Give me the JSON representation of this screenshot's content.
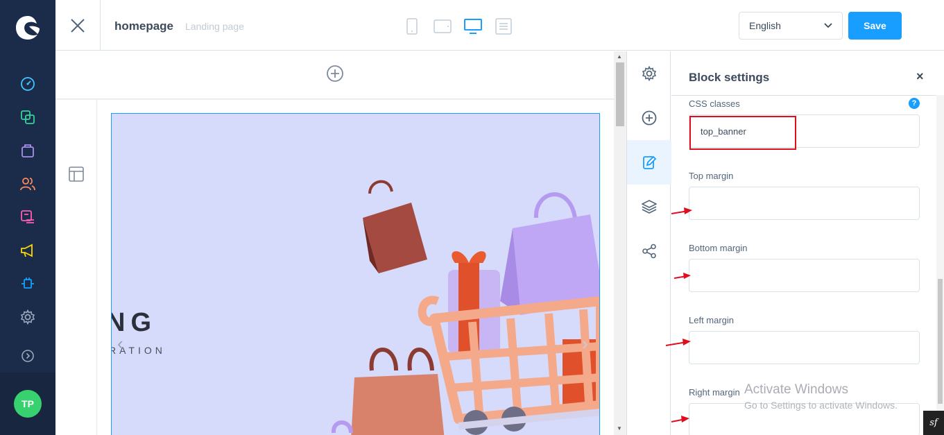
{
  "header": {
    "title": "homepage",
    "subtitle": "Landing page",
    "language": "English",
    "save_label": "Save"
  },
  "banner": {
    "headline": "NG",
    "tagline": "RATION"
  },
  "panel": {
    "title": "Block settings",
    "close_label": "×",
    "fields": [
      {
        "label": "CSS classes",
        "value": "top_banner"
      },
      {
        "label": "Top margin",
        "value": ""
      },
      {
        "label": "Bottom margin",
        "value": ""
      },
      {
        "label": "Left margin",
        "value": ""
      },
      {
        "label": "Right margin",
        "value": ""
      }
    ],
    "help": "?"
  },
  "user": {
    "initials": "TP"
  },
  "watermark": {
    "line1": "Activate Windows",
    "line2": "Go to Settings to activate Windows."
  },
  "badge": "sf",
  "colors": {
    "sidebar": "#1b2b4a",
    "accent": "#189eff",
    "avatar": "#37d26f",
    "highlight": "#e00d1f"
  },
  "icons": {
    "sidebar": [
      "dashboard-icon",
      "catalogue-icon",
      "orders-icon",
      "customers-icon",
      "content-icon",
      "marketing-icon",
      "extensions-icon",
      "settings-icon",
      "expand-icon"
    ],
    "devices": [
      "mobile-icon",
      "tablet-icon",
      "desktop-icon",
      "list-view-icon"
    ],
    "tools": [
      "settings-icon",
      "add-block-icon",
      "edit-block-icon",
      "layers-icon",
      "share-icon"
    ]
  }
}
